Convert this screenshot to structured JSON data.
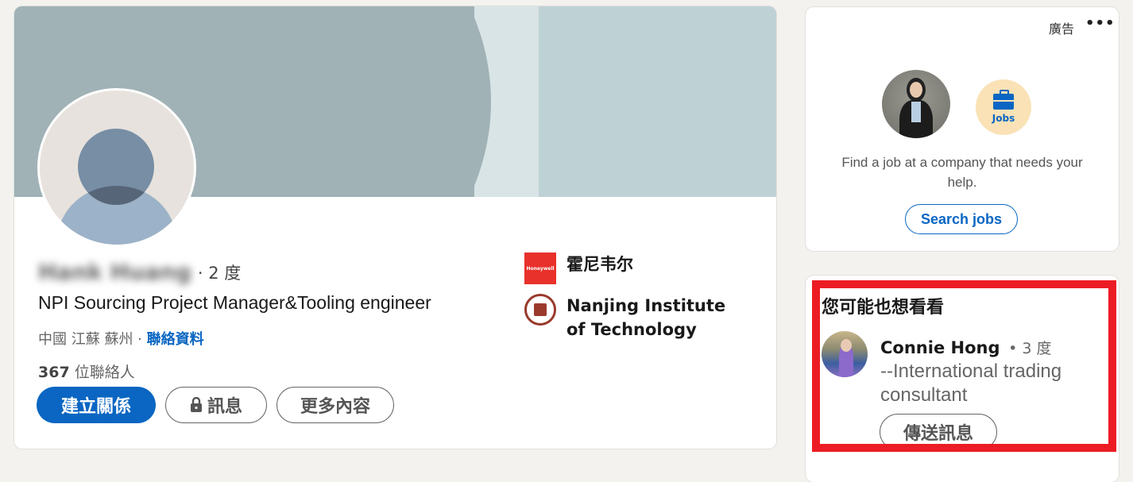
{
  "profile": {
    "name": "Hank Huang",
    "degree": "· 2 度",
    "headline": "NPI Sourcing Project Manager&Tooling engineer",
    "location": "中國 江蘇 蘇州 · ",
    "contact_info_link": "聯絡資料",
    "connections_count": "367",
    "connections_label": " 位聯絡人",
    "buttons": {
      "connect": "建立關係",
      "message": "訊息",
      "more": "更多內容"
    },
    "organizations": [
      {
        "name": "霍尼韦尔",
        "logo_text": "Honeywell",
        "logo_icon": "honeywell-logo"
      },
      {
        "name": "Nanjing Institute of Technology",
        "logo_icon": "school-seal-logo"
      }
    ]
  },
  "ad": {
    "label": "廣告",
    "more_icon": "ellipsis-icon",
    "jobs_badge": "Jobs",
    "text": "Find a job at a company that needs your help.",
    "button": "Search jobs"
  },
  "suggestions": {
    "title": "您可能也想看看",
    "items": [
      {
        "name": "Connie Hong",
        "degree": "• 3 度",
        "headline": "--International trading consultant",
        "button": "傳送訊息"
      }
    ]
  },
  "colors": {
    "brand_blue": "#0a66c2",
    "highlight_red": "#ec1c24",
    "page_bg": "#f3f2ef"
  }
}
